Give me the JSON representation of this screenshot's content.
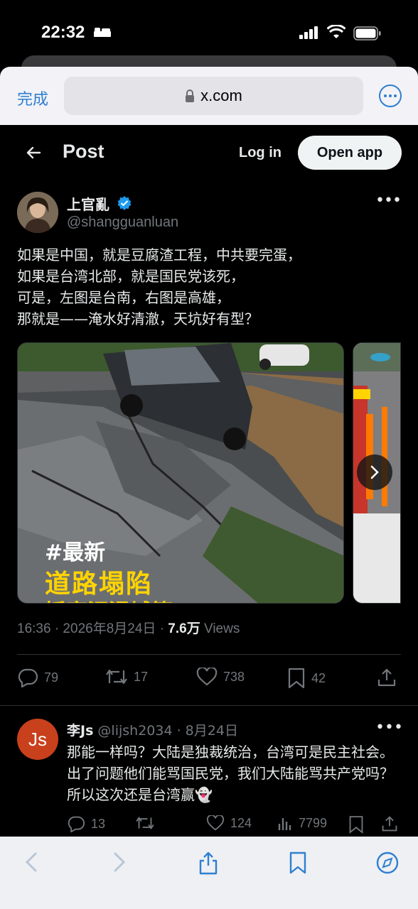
{
  "status_bar": {
    "time": "22:32"
  },
  "browser": {
    "done_label": "完成",
    "url": "x.com"
  },
  "header": {
    "title": "Post",
    "login_label": "Log in",
    "open_app_label": "Open app"
  },
  "post": {
    "author_name": "上官亂",
    "handle": "@shangguanluan",
    "text": "如果是中国，就是豆腐渣工程，中共要完蛋，\n如果是台湾北部，就是国民党该死，\n可是，左图是台南，右图是高雄，\n那就是——淹水好清澈，天坑好有型？",
    "media": {
      "tag": "#最新",
      "headline": "道路塌陷",
      "subline": "插塞泥浸城簫"
    },
    "time": "16:36 · 2026年8月24日 · ",
    "views": "7.6万",
    "views_label": " Views",
    "stats": {
      "replies": "79",
      "reposts": "17",
      "likes": "738",
      "bookmarks": "42"
    }
  },
  "reply": {
    "avatar_text": "Js",
    "name": "李Js",
    "handle_date": " @lijsh2034 · 8月24日",
    "text": "那能一样吗？大陆是独裁统治，台湾可是民主社会。出了问题他们能骂国民党，我们大陆能骂共产党吗？所以这次还是台湾赢👻",
    "stats": {
      "replies": "13",
      "likes": "124",
      "views": "7799"
    }
  },
  "colors": {
    "accent": "#1d9bf0",
    "safari_blue": "#2f7fd0",
    "reply_avatar": "#c9401c"
  }
}
